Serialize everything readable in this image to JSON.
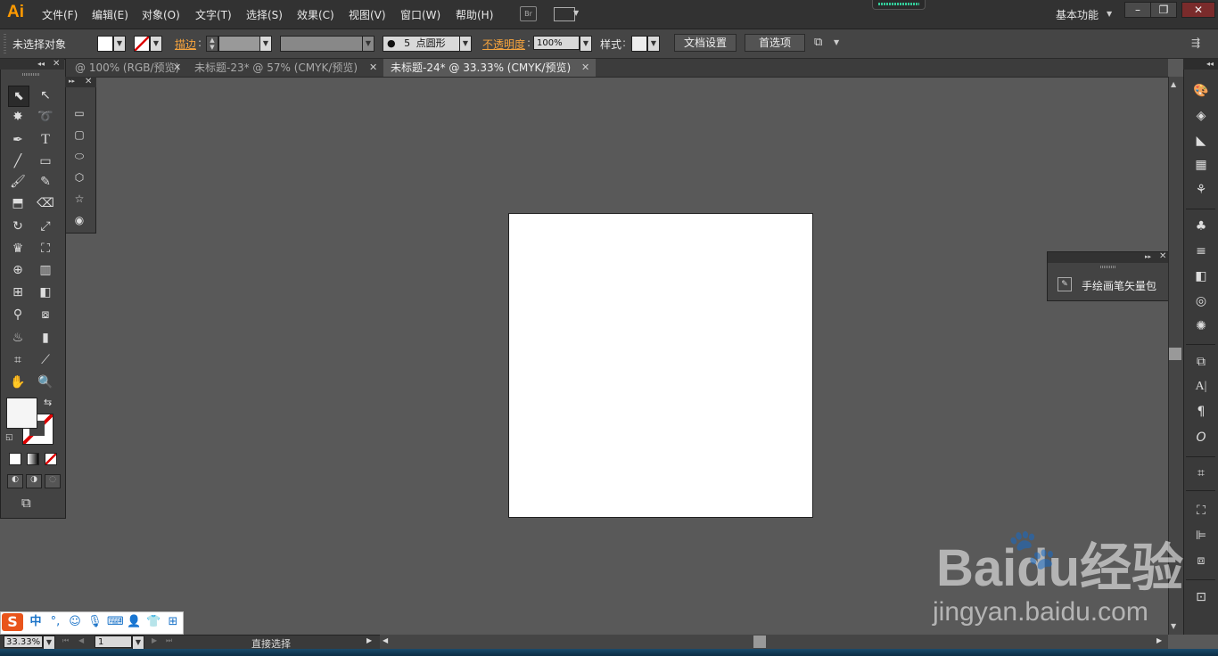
{
  "app": {
    "logo": "Ai"
  },
  "menu": [
    "文件(F)",
    "编辑(E)",
    "对象(O)",
    "文字(T)",
    "选择(S)",
    "效果(C)",
    "视图(V)",
    "窗口(W)",
    "帮助(H)"
  ],
  "bridge_label": "Br",
  "workspace": "基本功能",
  "control": {
    "selection": "未选择对象",
    "stroke_label": "描边",
    "brush_size": "5",
    "brush_shape": "点圆形",
    "opacity_label": "不透明度",
    "opacity_value": "100%",
    "style_label": "样式",
    "doc_setup": "文档设置",
    "preferences": "首选项"
  },
  "tabs": [
    {
      "label": "@ 100% (RGB/预览)",
      "active": false
    },
    {
      "label": "未标题-23* @ 57% (CMYK/预览)",
      "active": false
    },
    {
      "label": "未标题-24* @ 33.33% (CMYK/预览)",
      "active": true
    }
  ],
  "floating_panel": {
    "item": "手绘画笔矢量包"
  },
  "status": {
    "zoom": "33.33%",
    "page": "1",
    "tool": "直接选择"
  },
  "ime": {
    "mode": "中"
  },
  "watermark": {
    "brand": "Baidu经验",
    "url": "jingyan.baidu.com"
  }
}
